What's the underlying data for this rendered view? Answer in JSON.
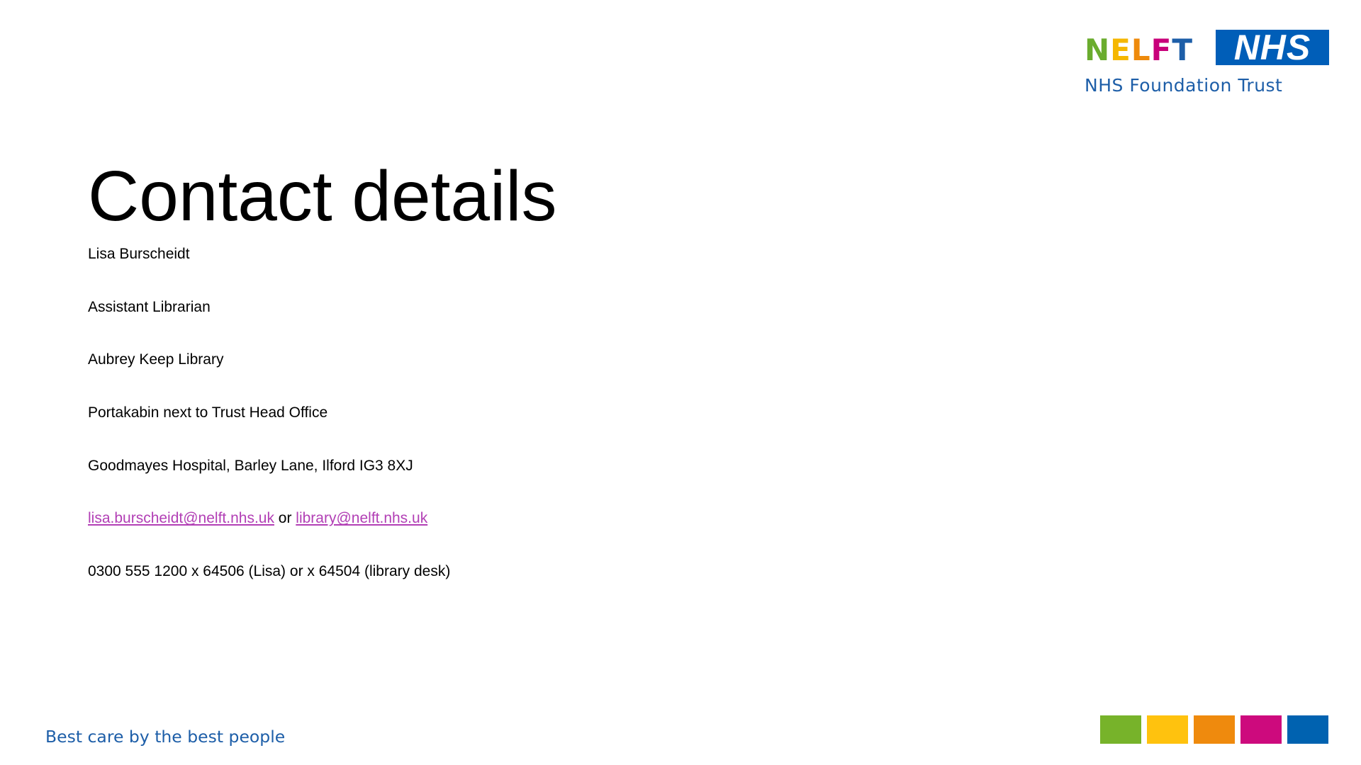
{
  "brand": {
    "nelft_letters": [
      {
        "char": "N",
        "color": "#6aac2e"
      },
      {
        "char": "E",
        "color": "#f5b700"
      },
      {
        "char": "L",
        "color": "#ee8a0c"
      },
      {
        "char": "F",
        "color": "#c8007a"
      },
      {
        "char": "T",
        "color": "#1d5ea8"
      }
    ],
    "nhs": "NHS",
    "foundation": "NHS Foundation Trust",
    "tagline": "Best care by the best people",
    "nhs_blue": "#005eb8",
    "swatches": [
      {
        "color": "#77b32a"
      },
      {
        "color": "#ffc20e"
      },
      {
        "color": "#ef8a0d"
      },
      {
        "color": "#cd0a7d"
      },
      {
        "color": "#0062b0"
      }
    ]
  },
  "slide": {
    "title": "Contact details",
    "name": "Lisa Burscheidt",
    "role": "Assistant Librarian",
    "library": "Aubrey Keep Library",
    "location": "Portakabin next to Trust Head Office",
    "address": "Goodmayes Hospital, Barley Lane, Ilford IG3 8XJ",
    "email_primary": "lisa.burscheidt@nelft.nhs.uk",
    "email_separator": " or ",
    "email_secondary": "library@nelft.nhs.uk",
    "phone": "0300 555 1200 x 64506 (Lisa) or x 64504 (library desk)",
    "link_color": "#b23fb5"
  }
}
